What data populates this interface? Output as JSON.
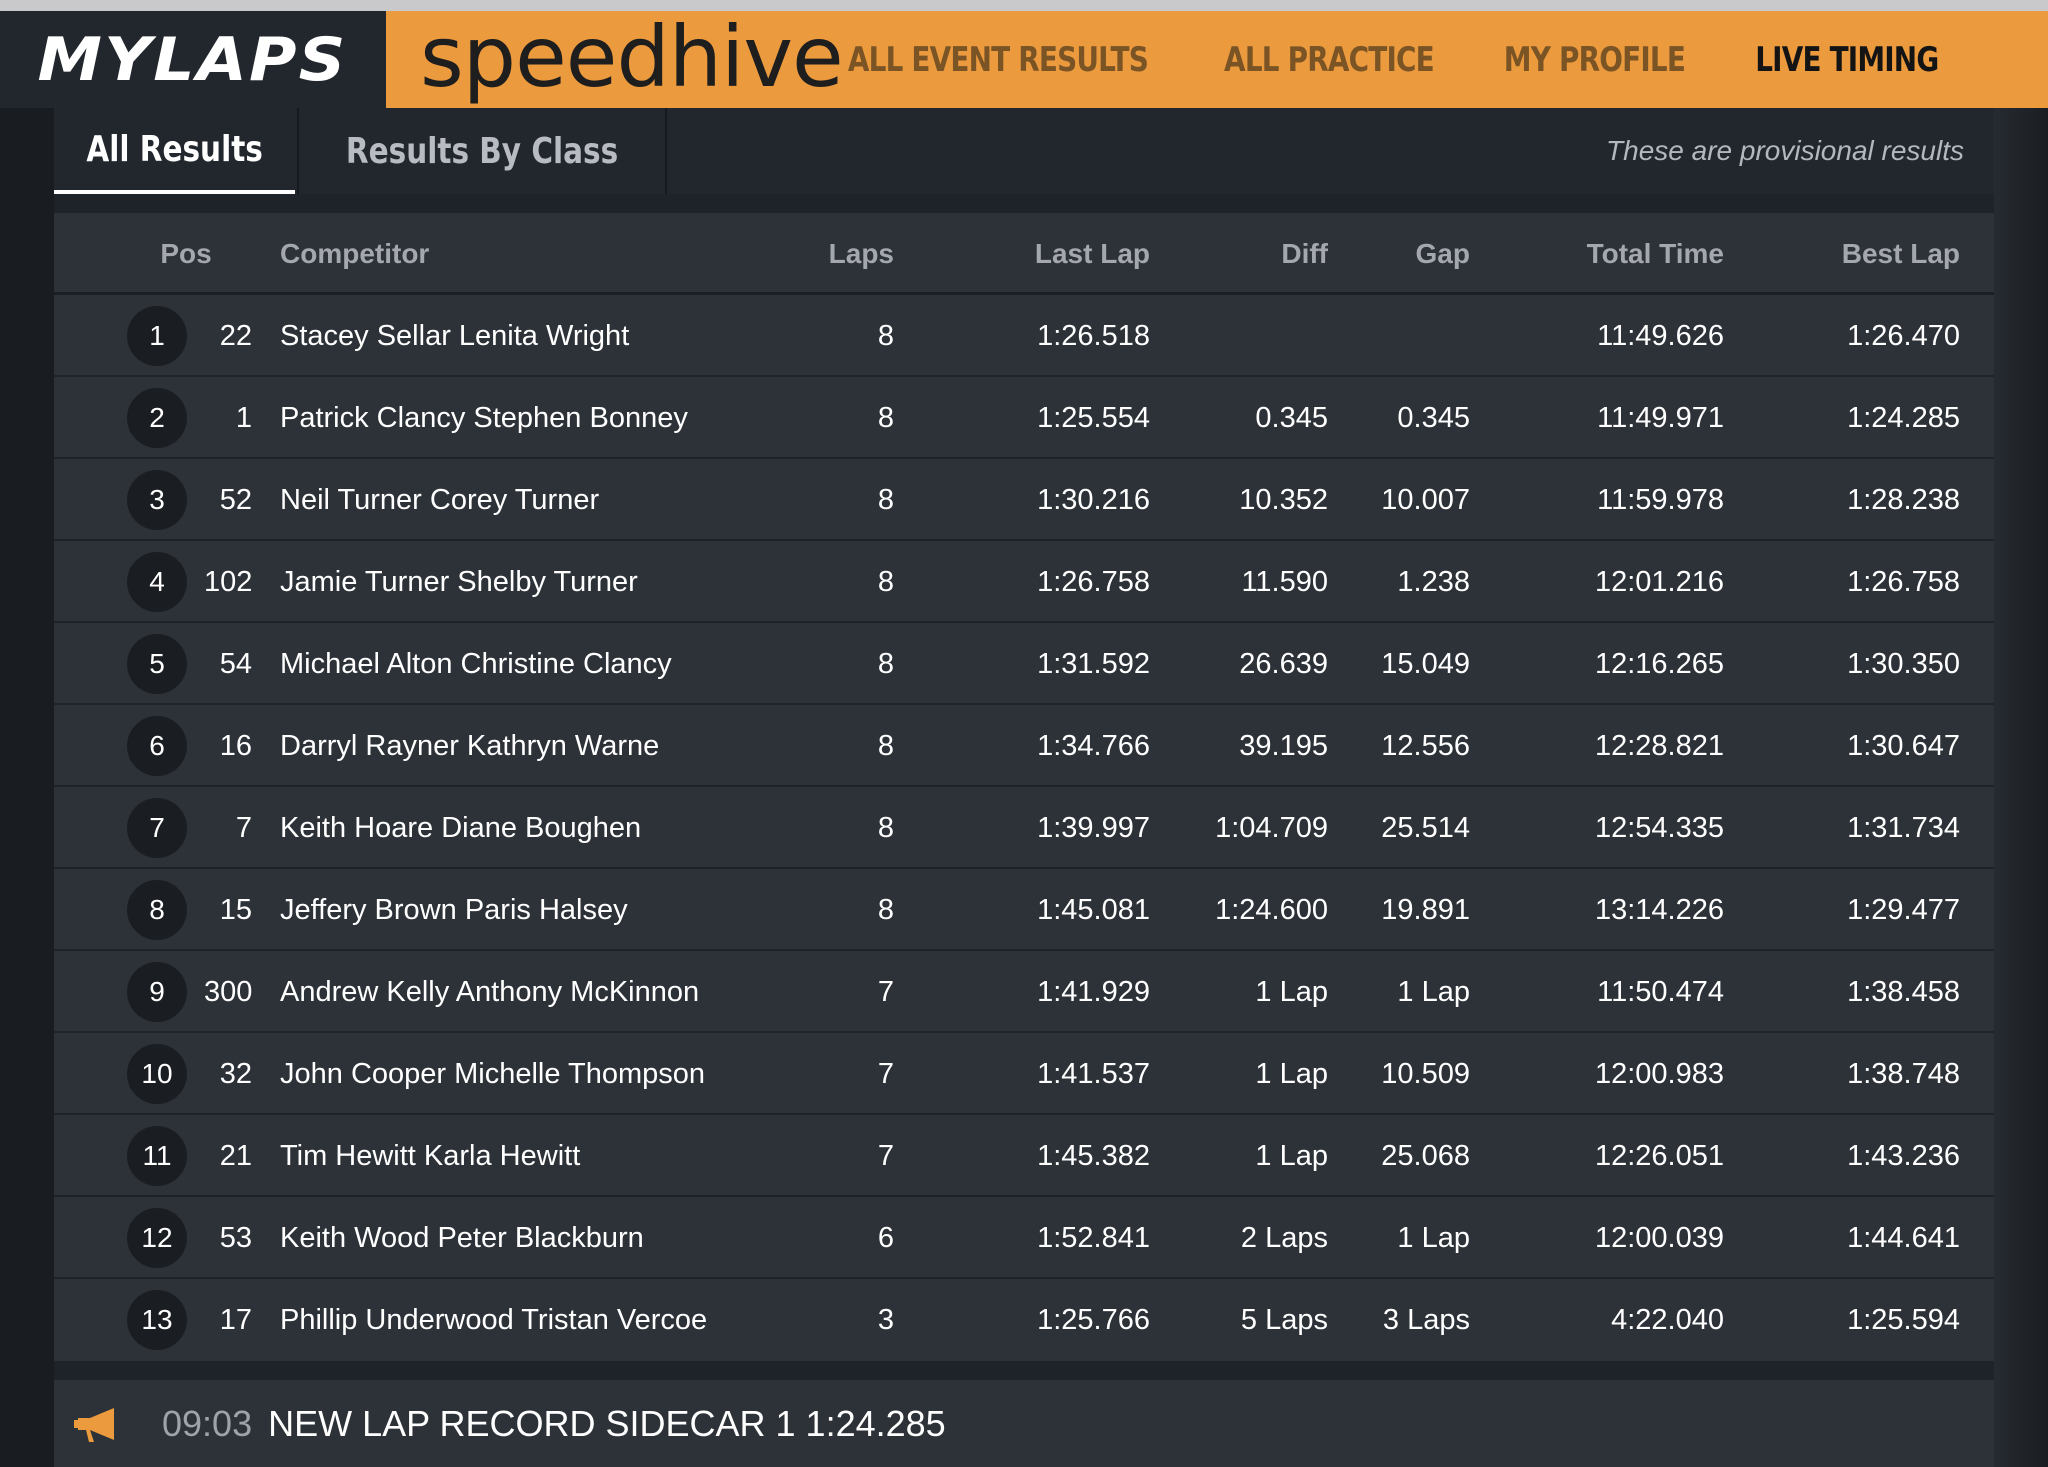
{
  "header": {
    "brand": "MYLAPS",
    "site": "speedhive",
    "nav": [
      {
        "label": "ALL EVENT RESULTS",
        "active": false
      },
      {
        "label": "ALL PRACTICE",
        "active": false
      },
      {
        "label": "MY PROFILE",
        "active": false
      },
      {
        "label": "LIVE TIMING",
        "active": true
      }
    ]
  },
  "tabs": {
    "all_results": "All Results",
    "results_by_class": "Results By Class",
    "active": "all_results"
  },
  "notice": "These are provisional results",
  "table": {
    "columns": {
      "pos": "Pos",
      "competitor": "Competitor",
      "laps": "Laps",
      "last_lap": "Last Lap",
      "diff": "Diff",
      "gap": "Gap",
      "total_time": "Total Time",
      "best_lap": "Best Lap"
    },
    "rows": [
      {
        "pos": "1",
        "number": "22",
        "competitor": "Stacey Sellar Lenita Wright",
        "laps": "8",
        "last_lap": "1:26.518",
        "diff": "",
        "gap": "",
        "total_time": "11:49.626",
        "best_lap": "1:26.470"
      },
      {
        "pos": "2",
        "number": "1",
        "competitor": "Patrick Clancy Stephen Bonney",
        "laps": "8",
        "last_lap": "1:25.554",
        "diff": "0.345",
        "gap": "0.345",
        "total_time": "11:49.971",
        "best_lap": "1:24.285"
      },
      {
        "pos": "3",
        "number": "52",
        "competitor": "Neil Turner Corey Turner",
        "laps": "8",
        "last_lap": "1:30.216",
        "diff": "10.352",
        "gap": "10.007",
        "total_time": "11:59.978",
        "best_lap": "1:28.238"
      },
      {
        "pos": "4",
        "number": "102",
        "competitor": "Jamie Turner Shelby Turner",
        "laps": "8",
        "last_lap": "1:26.758",
        "diff": "11.590",
        "gap": "1.238",
        "total_time": "12:01.216",
        "best_lap": "1:26.758"
      },
      {
        "pos": "5",
        "number": "54",
        "competitor": "Michael Alton Christine Clancy",
        "laps": "8",
        "last_lap": "1:31.592",
        "diff": "26.639",
        "gap": "15.049",
        "total_time": "12:16.265",
        "best_lap": "1:30.350"
      },
      {
        "pos": "6",
        "number": "16",
        "competitor": "Darryl Rayner Kathryn Warne",
        "laps": "8",
        "last_lap": "1:34.766",
        "diff": "39.195",
        "gap": "12.556",
        "total_time": "12:28.821",
        "best_lap": "1:30.647"
      },
      {
        "pos": "7",
        "number": "7",
        "competitor": "Keith Hoare Diane Boughen",
        "laps": "8",
        "last_lap": "1:39.997",
        "diff": "1:04.709",
        "gap": "25.514",
        "total_time": "12:54.335",
        "best_lap": "1:31.734"
      },
      {
        "pos": "8",
        "number": "15",
        "competitor": "Jeffery Brown Paris Halsey",
        "laps": "8",
        "last_lap": "1:45.081",
        "diff": "1:24.600",
        "gap": "19.891",
        "total_time": "13:14.226",
        "best_lap": "1:29.477"
      },
      {
        "pos": "9",
        "number": "300",
        "competitor": "Andrew Kelly Anthony McKinnon",
        "laps": "7",
        "last_lap": "1:41.929",
        "diff": "1 Lap",
        "gap": "1 Lap",
        "total_time": "11:50.474",
        "best_lap": "1:38.458"
      },
      {
        "pos": "10",
        "number": "32",
        "competitor": "John Cooper Michelle Thompson",
        "laps": "7",
        "last_lap": "1:41.537",
        "diff": "1 Lap",
        "gap": "10.509",
        "total_time": "12:00.983",
        "best_lap": "1:38.748"
      },
      {
        "pos": "11",
        "number": "21",
        "competitor": "Tim Hewitt Karla Hewitt",
        "laps": "7",
        "last_lap": "1:45.382",
        "diff": "1 Lap",
        "gap": "25.068",
        "total_time": "12:26.051",
        "best_lap": "1:43.236"
      },
      {
        "pos": "12",
        "number": "53",
        "competitor": "Keith Wood Peter Blackburn",
        "laps": "6",
        "last_lap": "1:52.841",
        "diff": "2 Laps",
        "gap": "1 Lap",
        "total_time": "12:00.039",
        "best_lap": "1:44.641"
      },
      {
        "pos": "13",
        "number": "17",
        "competitor": "Phillip Underwood Tristan Vercoe",
        "laps": "3",
        "last_lap": "1:25.766",
        "diff": "5 Laps",
        "gap": "3 Laps",
        "total_time": "4:22.040",
        "best_lap": "1:25.594"
      }
    ]
  },
  "announcement": {
    "icon": "megaphone-icon",
    "time": "09:03",
    "message": "NEW LAP RECORD SIDECAR 1 1:24.285"
  },
  "colors": {
    "accent": "#ec9a3e",
    "background": "#1e2329",
    "panel": "#2d3238"
  }
}
